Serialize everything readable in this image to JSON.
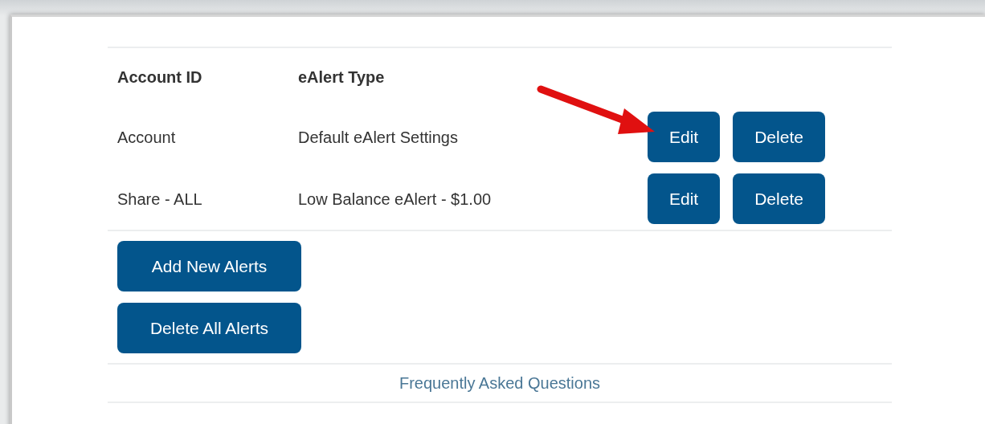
{
  "table": {
    "columns": [
      "Account ID",
      "eAlert Type"
    ],
    "rows": [
      {
        "account_id": "Account",
        "ealert_type": "Default eAlert Settings",
        "buttons": [
          "Edit",
          "Delete"
        ]
      },
      {
        "account_id": "Share - ALL",
        "ealert_type": "Low Balance eAlert - $1.00",
        "buttons": [
          "Edit",
          "Delete"
        ]
      }
    ]
  },
  "actions": [
    "Add New Alerts",
    "Delete All Alerts"
  ],
  "footer_link": "Frequently Asked Questions"
}
